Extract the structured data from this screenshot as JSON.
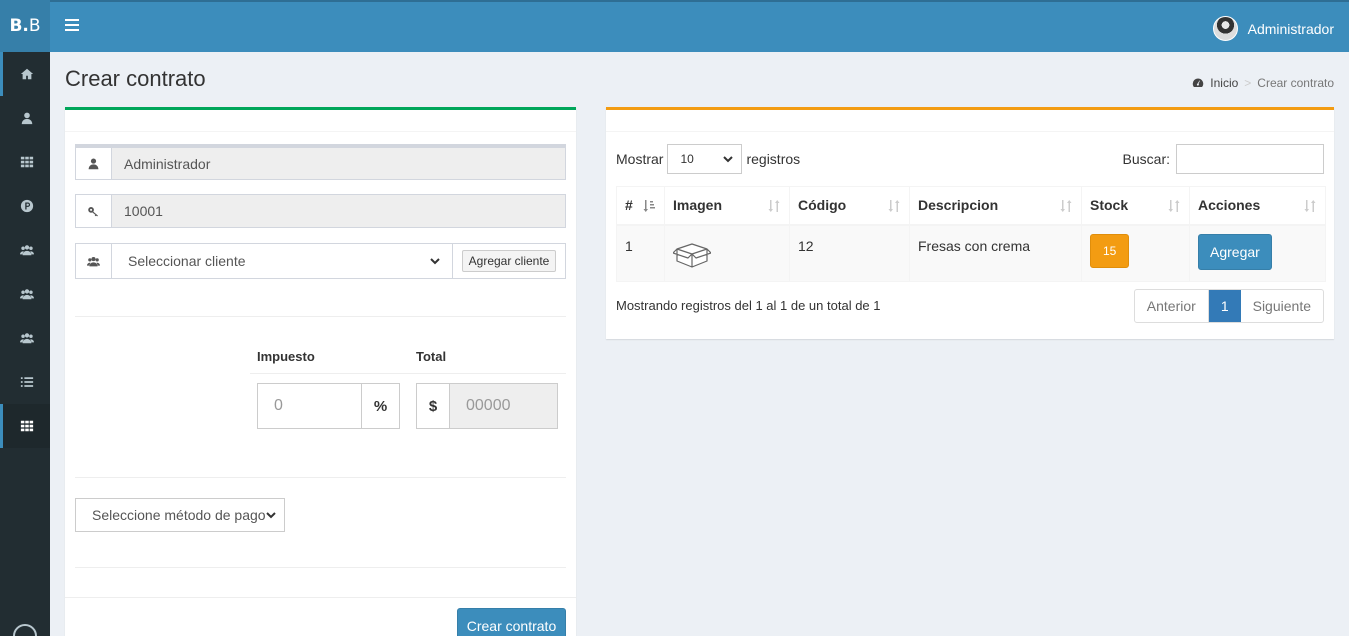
{
  "app": {
    "logo_bold": "B.",
    "logo_rest": " B"
  },
  "header": {
    "user_name": "Administrador"
  },
  "page": {
    "title": "Crear contrato"
  },
  "breadcrumb": {
    "home": "Inicio",
    "current": "Crear contrato"
  },
  "sidebar": {
    "icons": [
      "home-icon",
      "user-icon",
      "grid-icon",
      "parking-icon",
      "users-icon",
      "users-icon",
      "users-icon",
      "list-icon",
      "grid-icon"
    ],
    "active_index": 8
  },
  "form": {
    "seller": "Administrador",
    "code": "10001",
    "client_select": "Seleccionar cliente",
    "add_client": "Agregar cliente",
    "tax_label": "Impuesto",
    "total_label": "Total",
    "tax_value": "0",
    "tax_symbol": "%",
    "currency_symbol": "$",
    "total_value": "00000",
    "payment_select": "Seleccione método de pago",
    "submit": "Crear contrato"
  },
  "table": {
    "show_label": "Mostrar",
    "page_length": "10",
    "records_label": "registros",
    "search_label": "Buscar:",
    "columns": [
      "#",
      "Imagen",
      "Código",
      "Descripcion",
      "Stock",
      "Acciones"
    ],
    "rows": [
      {
        "num": "1",
        "code": "12",
        "description": "Fresas con crema",
        "stock": "15",
        "action": "Agregar"
      }
    ],
    "info": "Mostrando registros del 1 al 1 de un total de 1",
    "prev": "Anterior",
    "page": "1",
    "next": "Siguiente"
  },
  "colors": {
    "header": "#3c8dbc",
    "sidebar": "#222d32",
    "success": "#00a65a",
    "warning": "#f39c12"
  }
}
